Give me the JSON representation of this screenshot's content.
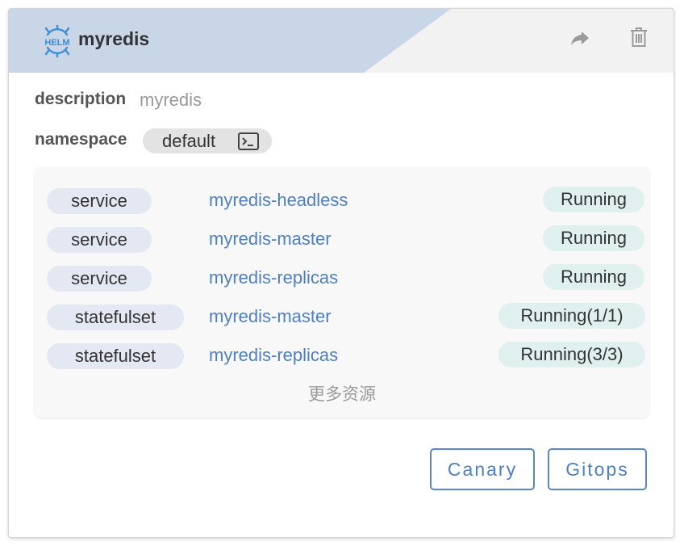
{
  "card": {
    "title": "myredis",
    "logo_text": "HELM",
    "icons": {
      "share": "share-arrow-icon",
      "delete": "trash-icon",
      "terminal": "terminal-icon",
      "logo": "helm-wheel-icon"
    },
    "colors": {
      "header_band": "#c9d6e8",
      "header_bg": "#f2f2f2",
      "link": "#4f7fbf",
      "status_chip": "#dff0ee",
      "kind_chip": "#e4e8f2",
      "button_border": "#5b86c4"
    }
  },
  "details": {
    "description_label": "description",
    "description_value": "myredis",
    "namespace_label": "namespace",
    "namespace_value": "default"
  },
  "resources": [
    {
      "kind": "service",
      "name": "myredis-headless",
      "status": "Running"
    },
    {
      "kind": "service",
      "name": "myredis-master",
      "status": "Running"
    },
    {
      "kind": "service",
      "name": "myredis-replicas",
      "status": "Running"
    },
    {
      "kind": "statefulset",
      "name": "myredis-master",
      "status": "Running(1/1)"
    },
    {
      "kind": "statefulset",
      "name": "myredis-replicas",
      "status": "Running(3/3)"
    }
  ],
  "more_resources_label": "更多资源",
  "buttons": {
    "canary": "Canary",
    "gitops": "Gitops"
  }
}
